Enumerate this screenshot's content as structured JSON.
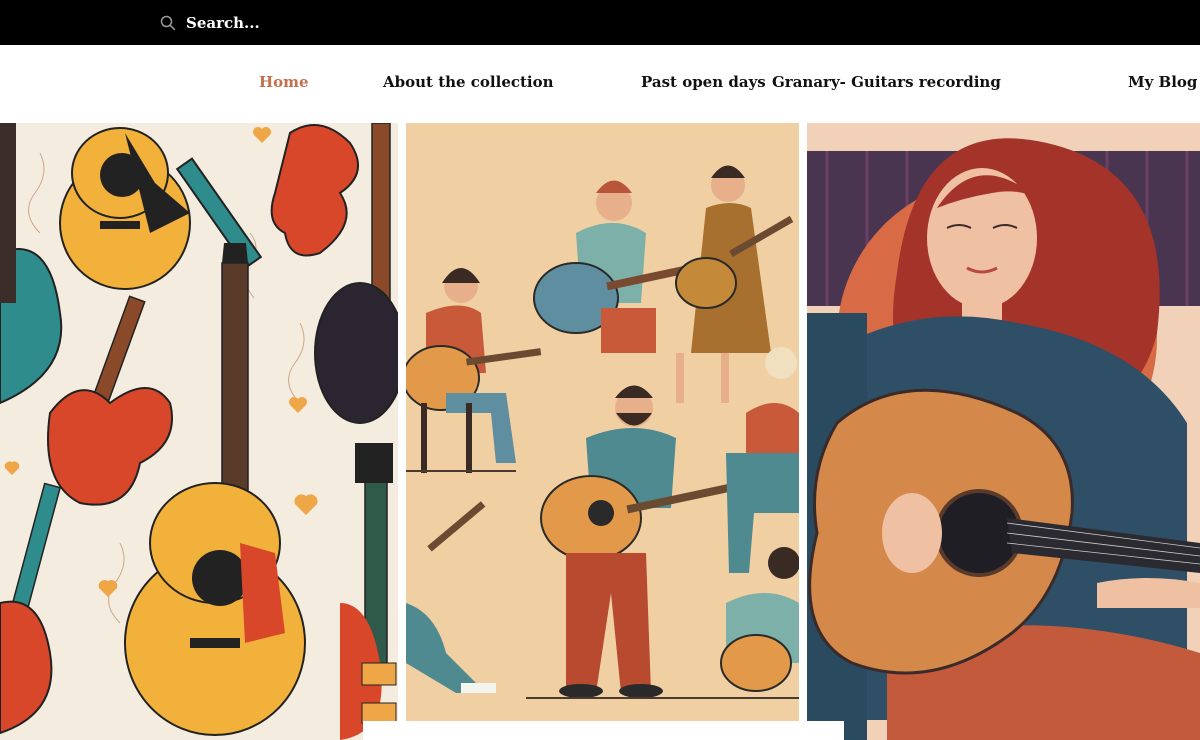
{
  "search": {
    "placeholder": "Search..."
  },
  "nav": {
    "items": [
      {
        "label": "Home",
        "active": true
      },
      {
        "label": "About the collection",
        "active": false
      },
      {
        "label": "Past open days",
        "active": false
      },
      {
        "label": "Granary- Guitars recording",
        "active": false
      },
      {
        "label": "My Blog",
        "active": false
      }
    ]
  },
  "colors": {
    "topbar": "#000000",
    "nav_active": "#c2704d",
    "nav_text": "#111111",
    "panel_cream": "#f5ece0",
    "panel_peach": "#f0cfa3",
    "guitar_yellow": "#f2b13b",
    "guitar_red": "#d9472b",
    "guitar_teal": "#2f8c8c"
  },
  "gallery": {
    "images": [
      {
        "name": "guitar-pattern-illustration"
      },
      {
        "name": "group-playing-guitars-illustration"
      },
      {
        "name": "woman-playing-acoustic-guitar-illustration"
      }
    ]
  }
}
